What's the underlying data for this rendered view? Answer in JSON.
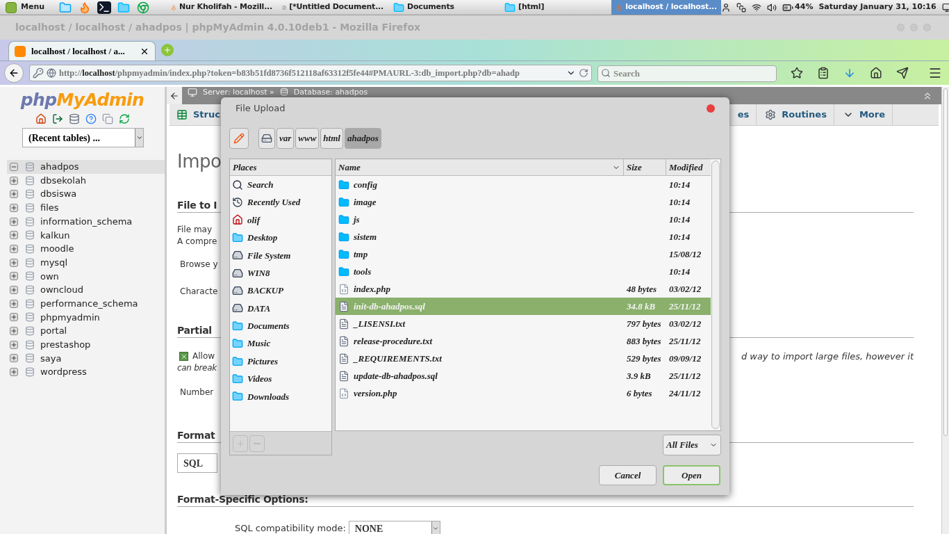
{
  "top_panel": {
    "menu_label": "Menu",
    "launchers": [
      {
        "kind": "files"
      },
      {
        "kind": "firefox"
      },
      {
        "kind": "terminal"
      },
      {
        "kind": "folder"
      },
      {
        "kind": "chrome"
      }
    ],
    "tasks": [
      {
        "label": "Nur Kholifah - Mozill...",
        "kind": "firefox",
        "selected": false
      },
      {
        "label": "[*Untitled Document...",
        "kind": "document",
        "selected": false
      },
      {
        "label": "Documents",
        "kind": "folder",
        "selected": false
      },
      {
        "label": "[html]",
        "kind": "folder",
        "selected": false
      },
      {
        "label": "localhost / localhost...",
        "kind": "firefox",
        "selected": true
      }
    ],
    "battery": "44%",
    "clock": "Saturday January 31, 10:16"
  },
  "window": {
    "title": "localhost / localhost / ahadpos | phpMyAdmin 4.0.10deb1 - Mozilla Firefox"
  },
  "browser": {
    "tabs": [
      {
        "label": "localhost / localhost / a...",
        "selected": true
      }
    ],
    "url": {
      "scheme": "http://",
      "host": "localhost",
      "path": "/phpmyadmin/index.php?token=b83b51fd8736f512118af63312f5fe44#PMAURL-3:db_import.php?db=ahadp"
    },
    "search": {
      "placeholder": "Search"
    }
  },
  "sidebar": {
    "logo": {
      "php": "php",
      "myadmin": "MyAdmin"
    },
    "recent_tables": "(Recent tables) ...",
    "databases": [
      {
        "name": "ahadpos",
        "expanded": true,
        "selected": true
      },
      {
        "name": "dbsekolah",
        "expanded": false,
        "selected": false
      },
      {
        "name": "dbsiswa",
        "expanded": false,
        "selected": false
      },
      {
        "name": "files",
        "expanded": false,
        "selected": false
      },
      {
        "name": "information_schema",
        "expanded": false,
        "selected": false
      },
      {
        "name": "kalkun",
        "expanded": false,
        "selected": false
      },
      {
        "name": "moodle",
        "expanded": false,
        "selected": false
      },
      {
        "name": "mysql",
        "expanded": false,
        "selected": false
      },
      {
        "name": "own",
        "expanded": false,
        "selected": false
      },
      {
        "name": "owncloud",
        "expanded": false,
        "selected": false
      },
      {
        "name": "performance_schema",
        "expanded": false,
        "selected": false
      },
      {
        "name": "phpmyadmin",
        "expanded": false,
        "selected": false
      },
      {
        "name": "portal",
        "expanded": false,
        "selected": false
      },
      {
        "name": "prestashop",
        "expanded": false,
        "selected": false
      },
      {
        "name": "saya",
        "expanded": false,
        "selected": false
      },
      {
        "name": "wordpress",
        "expanded": false,
        "selected": false
      }
    ]
  },
  "main": {
    "breadcrumb": [
      "Server: localhost »",
      "Database: ahadpos"
    ],
    "left_tabs": [
      {
        "label": "Struc",
        "kind": "structure"
      }
    ],
    "right_tabs": [
      {
        "label": "es",
        "kind": "plain"
      },
      {
        "label": "Routines",
        "kind": "routines"
      },
      {
        "label": "More",
        "kind": "more"
      }
    ],
    "title": "Impo",
    "file_section": {
      "heading": "File to I",
      "lines": [
        "File may",
        "A compre"
      ],
      "browse": "Browse y",
      "charset": "Characte"
    },
    "partial_section": {
      "heading": "Partial",
      "allow": {
        "label": "Allow",
        "checked": true
      },
      "note_right": "d way to import large files, however it",
      "note_left": "can break",
      "number": "Number"
    },
    "format_section": {
      "heading": "Format",
      "format": "SQL"
    },
    "options_section": {
      "heading": "Format-Specific Options:",
      "compat_label": "SQL compatibility mode:",
      "compat_value": "NONE"
    }
  },
  "dialog": {
    "title": "File Upload",
    "path": [
      {
        "label": "var",
        "selected": false
      },
      {
        "label": "www",
        "selected": false
      },
      {
        "label": "html",
        "selected": false
      },
      {
        "label": "ahadpos",
        "selected": true
      }
    ],
    "places_header": "Places",
    "places": [
      {
        "label": "Search",
        "kind": "search"
      },
      {
        "label": "Recently Used",
        "kind": "recent"
      },
      {
        "label": "olif",
        "kind": "home"
      },
      {
        "label": "Desktop",
        "kind": "folder"
      },
      {
        "label": "File System",
        "kind": "drive"
      },
      {
        "label": "WIN8",
        "kind": "drive"
      },
      {
        "label": "BACKUP",
        "kind": "drive"
      },
      {
        "label": "DATA",
        "kind": "drive"
      },
      {
        "label": "Documents",
        "kind": "folder"
      },
      {
        "label": "Music",
        "kind": "folder"
      },
      {
        "label": "Pictures",
        "kind": "folder"
      },
      {
        "label": "Videos",
        "kind": "folder"
      },
      {
        "label": "Downloads",
        "kind": "folder"
      }
    ],
    "columns": [
      "Name",
      "Size",
      "Modified"
    ],
    "files": [
      {
        "name": "config",
        "kind": "folder",
        "modified": "10:14",
        "selected": false
      },
      {
        "name": "image",
        "kind": "folder",
        "modified": "10:14",
        "selected": false
      },
      {
        "name": "js",
        "kind": "folder",
        "modified": "10:14",
        "selected": false
      },
      {
        "name": "sistem",
        "kind": "folder",
        "modified": "10:14",
        "selected": false
      },
      {
        "name": "tmp",
        "kind": "folder",
        "modified": "15/08/12",
        "selected": false
      },
      {
        "name": "tools",
        "kind": "folder",
        "modified": "10:14",
        "selected": false
      },
      {
        "name": "index.php",
        "kind": "code",
        "size": "48 bytes",
        "modified": "03/02/12",
        "selected": false
      },
      {
        "name": "init-db-ahadpos.sql",
        "kind": "text",
        "size": "34.8 kB",
        "modified": "25/11/12",
        "selected": true
      },
      {
        "name": "_LISENSI.txt",
        "kind": "text",
        "size": "797 bytes",
        "modified": "03/02/12",
        "selected": false
      },
      {
        "name": "release-procedure.txt",
        "kind": "text",
        "size": "883 bytes",
        "modified": "25/11/12",
        "selected": false
      },
      {
        "name": "_REQUIREMENTS.txt",
        "kind": "text",
        "size": "529 bytes",
        "modified": "09/09/12",
        "selected": false
      },
      {
        "name": "update-db-ahadpos.sql",
        "kind": "text",
        "size": "3.9 kB",
        "modified": "25/11/12",
        "selected": false
      },
      {
        "name": "version.php",
        "kind": "code",
        "size": "6 bytes",
        "modified": "24/11/12",
        "selected": false
      }
    ],
    "filter": "All Files",
    "buttons": [
      {
        "label": "Cancel",
        "kind": "secondary"
      },
      {
        "label": "Open",
        "kind": "primary"
      }
    ]
  }
}
